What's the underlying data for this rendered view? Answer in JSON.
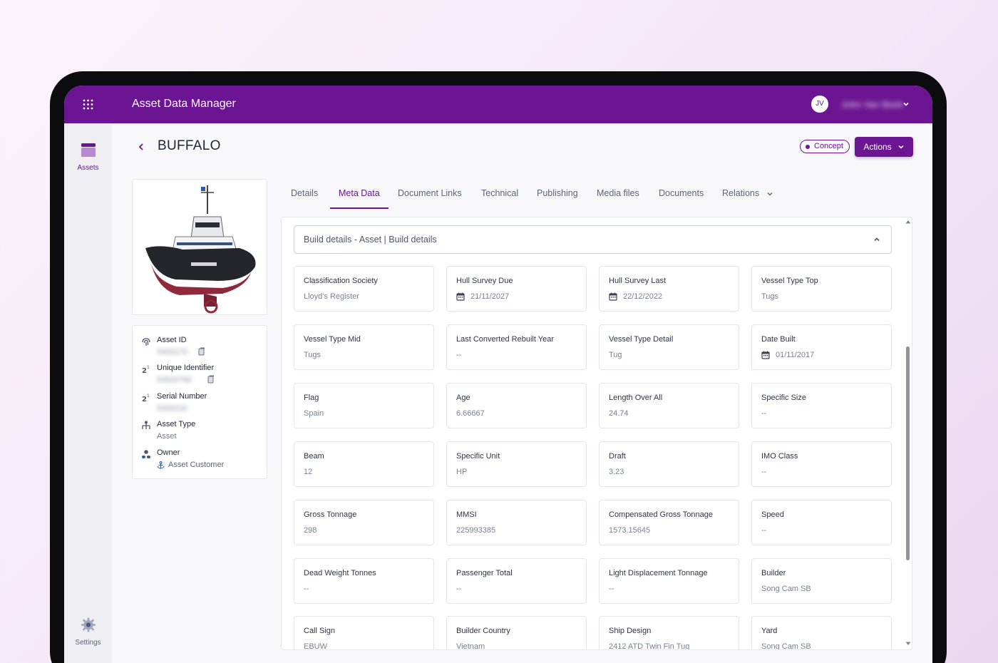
{
  "app": {
    "title": "Asset Data Manager"
  },
  "user": {
    "initials": "JV",
    "name": "John Van Beek"
  },
  "sidebar": {
    "items": [
      {
        "label": "Assets",
        "icon": "assets-icon"
      },
      {
        "label": "Settings",
        "icon": "gear-icon"
      }
    ]
  },
  "page": {
    "title": "BUFFALO",
    "status": "Concept",
    "actions_label": "Actions"
  },
  "asset_info": {
    "asset_id_label": "Asset ID",
    "asset_id_value": "5400270",
    "unique_identifier_label": "Unique Identifier",
    "unique_identifier_value": "54500766",
    "serial_number_label": "Serial Number",
    "serial_number_value": "5400216",
    "asset_type_label": "Asset Type",
    "asset_type_value": "Asset",
    "owner_label": "Owner",
    "owner_value": "Asset Customer"
  },
  "tabs": [
    {
      "label": "Details"
    },
    {
      "label": "Meta Data",
      "active": true
    },
    {
      "label": "Document Links"
    },
    {
      "label": "Technical"
    },
    {
      "label": "Publishing"
    },
    {
      "label": "Media files"
    },
    {
      "label": "Documents"
    },
    {
      "label": "Relations"
    }
  ],
  "section": {
    "title": "Build details - Asset | Build details"
  },
  "fields": [
    {
      "label": "Classification Society",
      "value": "Lloyd's Register"
    },
    {
      "label": "Hull Survey Due",
      "value": "21/11/2027",
      "date": true
    },
    {
      "label": "Hull Survey Last",
      "value": "22/12/2022",
      "date": true
    },
    {
      "label": "Vessel Type Top",
      "value": "Tugs"
    },
    {
      "label": "Vessel Type Mid",
      "value": "Tugs"
    },
    {
      "label": "Last Converted Rebuilt Year",
      "value": "--"
    },
    {
      "label": "Vessel Type Detail",
      "value": "Tug"
    },
    {
      "label": "Date Built",
      "value": "01/11/2017",
      "date": true
    },
    {
      "label": "Flag",
      "value": "Spain"
    },
    {
      "label": "Age",
      "value": "6.66667"
    },
    {
      "label": "Length Over All",
      "value": "24.74"
    },
    {
      "label": "Specific Size",
      "value": "--"
    },
    {
      "label": "Beam",
      "value": "12"
    },
    {
      "label": "Specific Unit",
      "value": "HP"
    },
    {
      "label": "Draft",
      "value": "3.23"
    },
    {
      "label": "IMO Class",
      "value": "--"
    },
    {
      "label": "Gross Tonnage",
      "value": "298"
    },
    {
      "label": "MMSI",
      "value": "225993385"
    },
    {
      "label": "Compensated Gross Tonnage",
      "value": "1573.15645"
    },
    {
      "label": "Speed",
      "value": "--"
    },
    {
      "label": "Dead Weight Tonnes",
      "value": "--"
    },
    {
      "label": "Passenger Total",
      "value": "--"
    },
    {
      "label": "Light Displacement Tonnage",
      "value": "--"
    },
    {
      "label": "Builder",
      "value": "Song Cam SB"
    },
    {
      "label": "Call Sign",
      "value": "EBUW"
    },
    {
      "label": "Builder Country",
      "value": "Vietnam"
    },
    {
      "label": "Ship Design",
      "value": "2412 ATD Twin Fin Tug"
    },
    {
      "label": "Yard",
      "value": "Song Cam SB"
    }
  ],
  "colors": {
    "brand": "#6b1592",
    "background": "#f8f8fb"
  }
}
